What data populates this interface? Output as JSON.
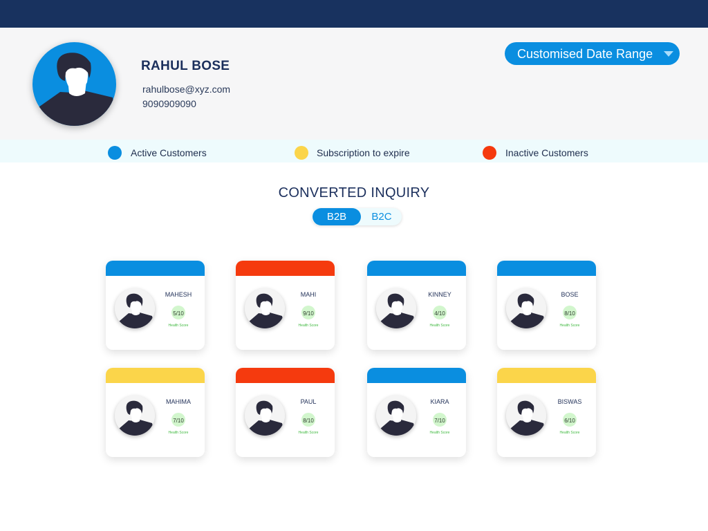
{
  "colors": {
    "active": "#0a8ee0",
    "expiring": "#fbd54a",
    "inactive": "#f53a0e",
    "navy": "#18325f"
  },
  "profile": {
    "name": "RAHUL BOSE",
    "email": "rahulbose@xyz.com",
    "phone": "9090909090",
    "avatar_icon": "user-avatar-icon"
  },
  "date_range": {
    "label": "Customised Date Range",
    "icon": "caret-down-icon"
  },
  "legend": [
    {
      "label": "Active Customers",
      "status": "active"
    },
    {
      "label": "Subscription to expire",
      "status": "expiring"
    },
    {
      "label": "Inactive Customers",
      "status": "inactive"
    }
  ],
  "section": {
    "title": "CONVERTED INQUIRY"
  },
  "toggle": {
    "options": [
      "B2B",
      "B2C"
    ],
    "selected": "B2B"
  },
  "score_label": "Health Score",
  "customers": [
    {
      "name": "MAHESH",
      "score": "5/10",
      "status": "active"
    },
    {
      "name": "MAHI",
      "score": "9/10",
      "status": "inactive"
    },
    {
      "name": "KINNEY",
      "score": "4/10",
      "status": "active"
    },
    {
      "name": "BOSE",
      "score": "8/10",
      "status": "active"
    },
    {
      "name": "MAHIMA",
      "score": "7/10",
      "status": "expiring"
    },
    {
      "name": "PAUL",
      "score": "8/10",
      "status": "inactive"
    },
    {
      "name": "KIARA",
      "score": "7/10",
      "status": "active"
    },
    {
      "name": "BISWAS",
      "score": "6/10",
      "status": "expiring"
    }
  ]
}
